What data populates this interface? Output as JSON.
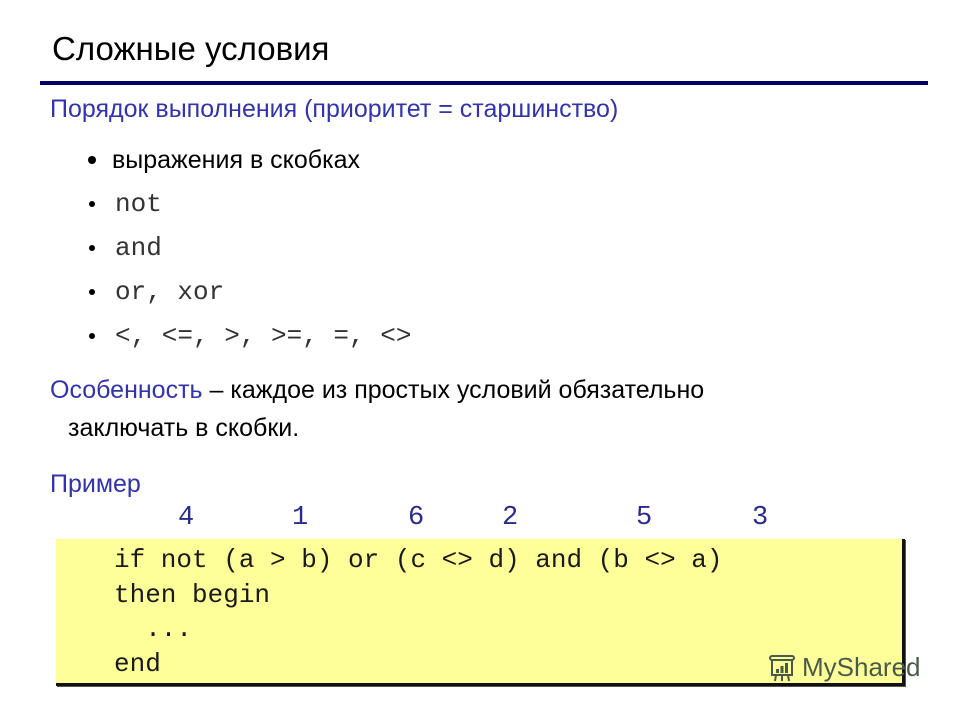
{
  "slide": {
    "title": "Сложные условия",
    "priority_heading": "Порядок выполнения (приоритет = старшинство)",
    "priority_list": [
      {
        "text": "выражения в скобках",
        "code": false
      },
      {
        "text": "not",
        "code": true
      },
      {
        "text": "and",
        "code": true
      },
      {
        "text": "or, xor",
        "code": true
      },
      {
        "text": "<, <=, >, >=, =, <>",
        "code": true
      }
    ],
    "feature_label": "Особенность",
    "feature_text_line1": " – каждое из простых условий обязательно",
    "feature_text_line2": "заключать в скобки.",
    "example_label": "Пример",
    "evaluation_order": [
      "4",
      "1",
      "6",
      "2",
      "5",
      "3"
    ],
    "code_lines": [
      "if not (a > b) or (c <> d) and (b <> a)",
      "then begin",
      "  ...",
      "end"
    ],
    "watermark": "MyShared"
  },
  "colors": {
    "accent_blue": "#3333aa",
    "rule": "#000066",
    "code_background": "#ffff99"
  }
}
